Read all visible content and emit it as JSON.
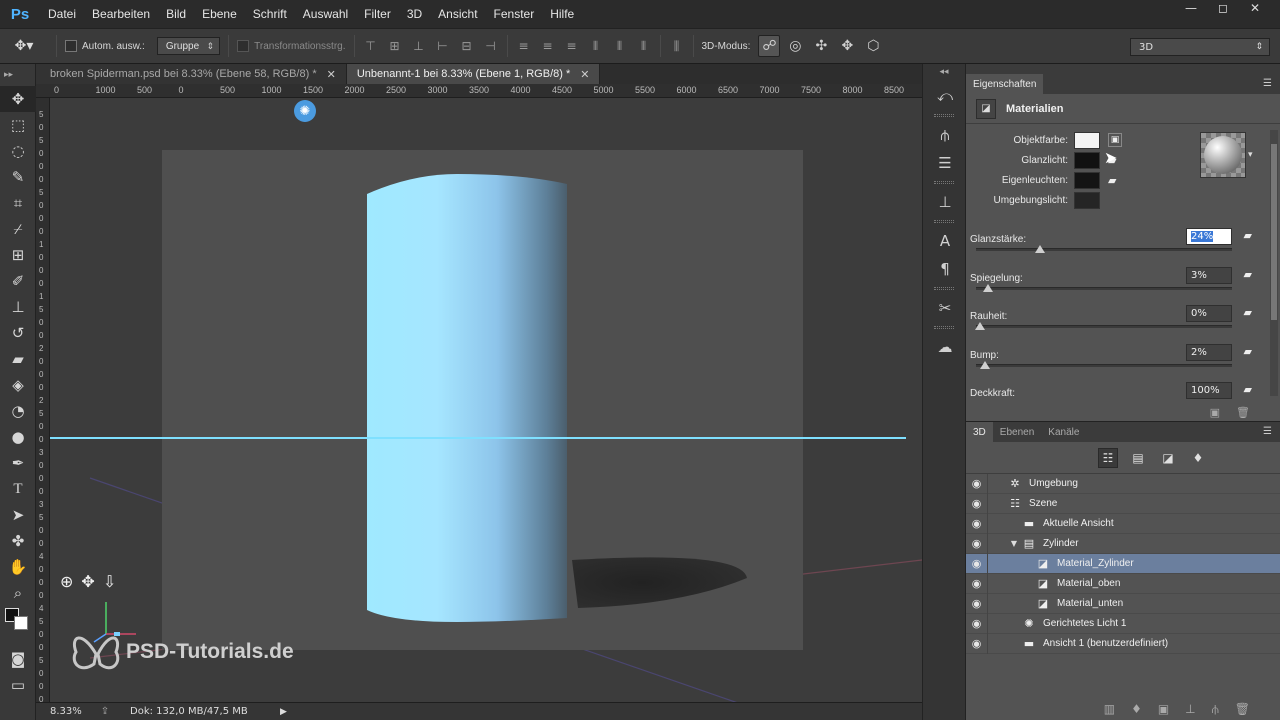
{
  "app": {
    "logo": "Ps"
  },
  "menu": [
    "Datei",
    "Bearbeiten",
    "Bild",
    "Ebene",
    "Schrift",
    "Auswahl",
    "Filter",
    "3D",
    "Ansicht",
    "Fenster",
    "Hilfe"
  ],
  "window_controls": {
    "minimize": "—",
    "restore": "◻",
    "close": "✕"
  },
  "options": {
    "auto_select_label": "Autom. ausw.:",
    "auto_select_value": "Gruppe",
    "transform_label": "Transformationsstrg.",
    "mode_label": "3D-Modus:",
    "workspace": "3D"
  },
  "tabs": [
    {
      "label": "broken Spiderman.psd bei 8.33% (Ebene 58, RGB/8) *",
      "close": "✕"
    },
    {
      "label": "Unbenannt-1 bei 8.33% (Ebene 1, RGB/8) *",
      "close": "✕"
    }
  ],
  "ruler_h": [
    "0",
    "1000",
    "500",
    "0",
    "500",
    "1000",
    "1500",
    "2000",
    "2500",
    "3000",
    "3500",
    "4000",
    "4500",
    "5000",
    "5500",
    "6000",
    "6500",
    "7000",
    "7500",
    "8000",
    "8500"
  ],
  "ruler_v": [
    "5",
    "0",
    "5",
    "0",
    "0",
    "0",
    "5",
    "0",
    "0",
    "0",
    "1",
    "0",
    "0",
    "0",
    "1",
    "5",
    "0",
    "0",
    "2",
    "0",
    "0",
    "0",
    "2",
    "5",
    "0",
    "0",
    "3",
    "0",
    "0",
    "0",
    "3",
    "5",
    "0",
    "0",
    "4",
    "0",
    "0",
    "0",
    "4",
    "5",
    "0",
    "0",
    "5",
    "0",
    "0",
    "0"
  ],
  "status": {
    "zoom": "8.33%",
    "doc": "Dok: 132,0 MB/47,5 MB"
  },
  "watermark": "PSD-Tutorials.de",
  "properties": {
    "tab": "Eigenschaften",
    "title": "Materialien",
    "labels": {
      "object_color": "Objektfarbe:",
      "specular": "Glanzlicht:",
      "illumination": "Eigenleuchten:",
      "ambient": "Umgebungslicht:"
    },
    "swatches": {
      "object_color": "#f4f4f4",
      "specular": "#111111",
      "illumination": "#141414",
      "ambient": "#252525"
    },
    "sliders": [
      {
        "label": "Glanzstärke:",
        "value": "24%",
        "pos": 0.24
      },
      {
        "label": "Spiegelung:",
        "value": "3%",
        "pos": 0.03
      },
      {
        "label": "Rauheit:",
        "value": "0%",
        "pos": 0.0
      },
      {
        "label": "Bump:",
        "value": "2%",
        "pos": 0.02
      },
      {
        "label": "Deckkraft:",
        "value": "100%",
        "pos": 1.0
      }
    ]
  },
  "panel3d": {
    "tabs": [
      "3D",
      "Ebenen",
      "Kanäle"
    ],
    "tree": [
      {
        "label": "Umgebung",
        "indent": 0,
        "icon": "✲"
      },
      {
        "label": "Szene",
        "indent": 0,
        "icon": "☷"
      },
      {
        "label": "Aktuelle Ansicht",
        "indent": 1,
        "icon": "▬"
      },
      {
        "label": "Zylinder",
        "indent": 1,
        "icon": "▤",
        "toggle": "▼"
      },
      {
        "label": "Material_Zylinder",
        "indent": 2,
        "icon": "◪",
        "selected": true
      },
      {
        "label": "Material_oben",
        "indent": 2,
        "icon": "◪"
      },
      {
        "label": "Material_unten",
        "indent": 2,
        "icon": "◪"
      },
      {
        "label": "Gerichtetes Licht 1",
        "indent": 1,
        "icon": "✺"
      },
      {
        "label": "Ansicht 1 (benutzerdefiniert)",
        "indent": 1,
        "icon": "▬"
      }
    ]
  }
}
